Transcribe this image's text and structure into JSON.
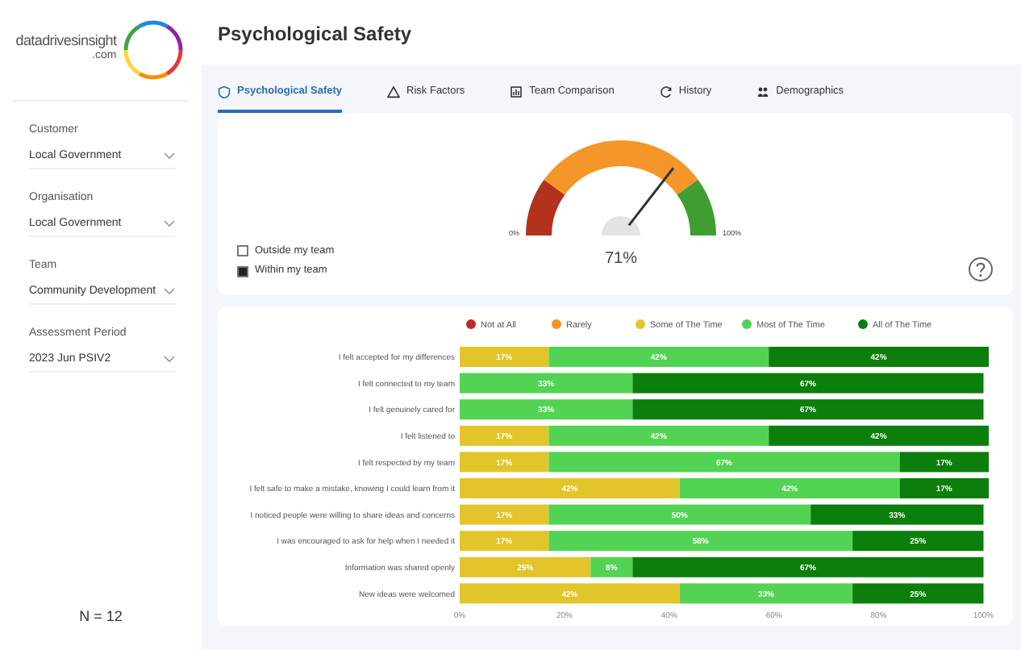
{
  "logo": {
    "name": "datadrivesinsight",
    "domain": ".com"
  },
  "page_title": "Psychological Safety",
  "filters": [
    {
      "label": "Customer",
      "value": "Local Government"
    },
    {
      "label": "Organisation",
      "value": "Local Government"
    },
    {
      "label": "Team",
      "value": "Community Development"
    },
    {
      "label": "Assessment Period",
      "value": "2023 Jun PSIV2"
    }
  ],
  "sample_size": "N = 12",
  "tabs": [
    {
      "label": "Psychological Safety",
      "selected": true
    },
    {
      "label": "Risk Factors",
      "selected": false
    },
    {
      "label": "Team Comparison",
      "selected": false
    },
    {
      "label": "History",
      "selected": false
    },
    {
      "label": "Demographics",
      "selected": false
    }
  ],
  "gauge": {
    "reading": "71%",
    "min_label": "0%",
    "max_label": "100%",
    "legend": [
      {
        "label": "Outside my team",
        "color": "#ffffff"
      },
      {
        "label": "Within my team",
        "color": "#222222"
      }
    ]
  },
  "chart": {
    "chart_data": {
      "type": "bar",
      "orientation": "horizontal",
      "stacked": true,
      "legend": "top",
      "categories": [
        "I felt accepted for my differences",
        "I felt connected to my team",
        "I felt genuinely cared for",
        "I felt listened to",
        "I felt respected by my team",
        "I felt safe to make a mistake, knowing I could learn from it",
        "I noticed people were willing to share ideas and concerns",
        "I was encouraged to ask for help when I needed it",
        "Information was shared openly",
        "New ideas were welcomed"
      ],
      "series": [
        {
          "name": "Not at All",
          "color": "#c0282d",
          "values": [
            0,
            0,
            0,
            0,
            0,
            0,
            0,
            0,
            0,
            0
          ],
          "value_labels": [
            null,
            null,
            null,
            null,
            null,
            null,
            null,
            null,
            null,
            null
          ]
        },
        {
          "name": "Rarely",
          "color": "#f39324",
          "values": [
            0,
            0,
            0,
            0,
            0,
            0,
            0,
            0,
            0,
            0
          ],
          "value_labels": [
            null,
            null,
            null,
            null,
            null,
            null,
            null,
            null,
            null,
            null
          ]
        },
        {
          "name": "Some of The Time",
          "color": "#e2c52a",
          "values": [
            17,
            0,
            0,
            17,
            17,
            42,
            17,
            17,
            25,
            42
          ],
          "value_labels": [
            "17%",
            null,
            null,
            "17%",
            "17%",
            "42%",
            "17%",
            "17%",
            "25%",
            "42%"
          ]
        },
        {
          "name": "Most of The Time",
          "color": "#53d353",
          "values": [
            42,
            33,
            33,
            42,
            67,
            42,
            50,
            58,
            8,
            33
          ],
          "value_labels": [
            "42%",
            "33%",
            "33%",
            "42%",
            "67%",
            "42%",
            "50%",
            "58%",
            "8%",
            "33%"
          ]
        },
        {
          "name": "All of The Time",
          "color": "#0b7e0b",
          "values": [
            42,
            67,
            67,
            42,
            17,
            17,
            33,
            25,
            67,
            25
          ],
          "value_labels": [
            "42%",
            "67%",
            "67%",
            "42%",
            "17%",
            "17%",
            "33%",
            "25%",
            "67%",
            "25%"
          ]
        }
      ],
      "xlim": [
        0,
        101
      ],
      "xticks": [
        {
          "value": 0,
          "label": "0%"
        },
        {
          "value": 20,
          "label": "20%"
        },
        {
          "value": 40,
          "label": "40%"
        },
        {
          "value": 60,
          "label": "60%"
        },
        {
          "value": 80,
          "label": "80%"
        },
        {
          "value": 100,
          "label": "100%"
        }
      ]
    }
  }
}
